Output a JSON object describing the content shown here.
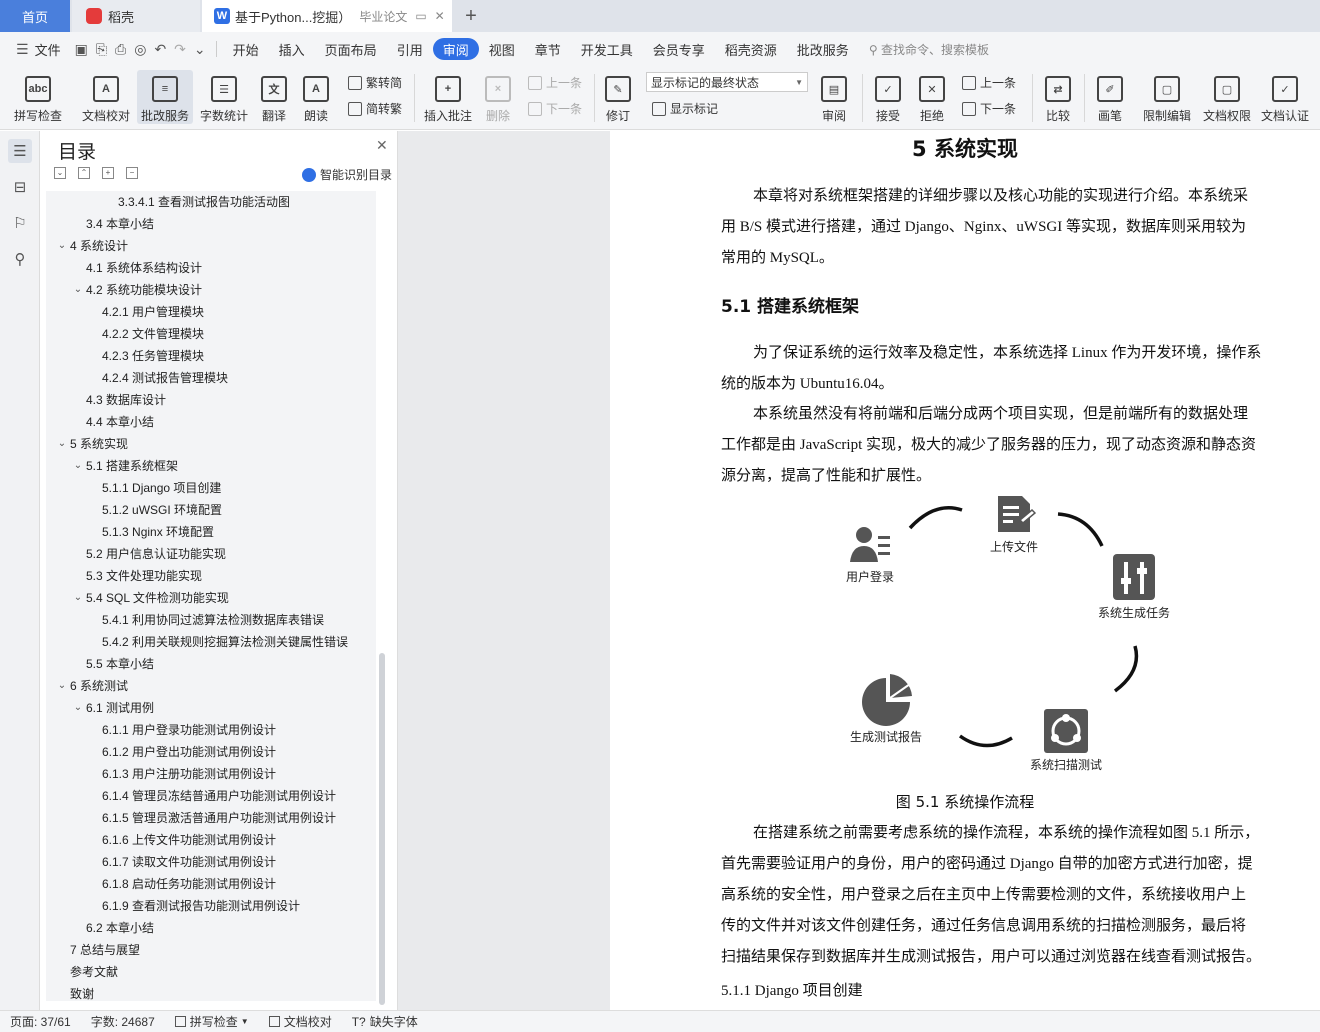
{
  "tabs": {
    "home": "首页",
    "docer": "稻壳",
    "doc_title": "基于Python...挖掘）",
    "doc_extra": "毕业论文"
  },
  "menubar": {
    "file": "文件",
    "items": [
      "开始",
      "插入",
      "页面布局",
      "引用",
      "审阅",
      "视图",
      "章节",
      "开发工具",
      "会员专享",
      "稻壳资源",
      "批改服务"
    ],
    "active_index": 4,
    "search": "查找命令、搜索模板"
  },
  "ribbon": {
    "spell": "拼写检查",
    "proofread": "文档校对",
    "review_service": "批改服务",
    "word_count": "字数统计",
    "translate": "翻译",
    "read_aloud": "朗读",
    "trad_to_simp": "繁转简",
    "simp_to_trad": "简转繁",
    "insert_comment": "插入批注",
    "delete": "删除",
    "prev_comment": "上一条",
    "next_comment": "下一条",
    "track": "修订",
    "markup_state": "显示标记的最终状态",
    "show_markup": "显示标记",
    "review_pane": "审阅",
    "accept": "接受",
    "reject": "拒绝",
    "prev_change": "上一条",
    "next_change": "下一条",
    "compare": "比较",
    "pen": "画笔",
    "restrict": "限制编辑",
    "permission": "文档权限",
    "certify": "文档认证"
  },
  "toc": {
    "title": "目录",
    "smart": "智能识别目录",
    "items": [
      {
        "text": "3.3.4.1  查看测试报告功能活动图",
        "level": 3,
        "ex": ""
      },
      {
        "text": "3.4  本章小结",
        "level": 1,
        "ex": ""
      },
      {
        "text": "4  系统设计",
        "level": 0,
        "ex": "v"
      },
      {
        "text": "4.1  系统体系结构设计",
        "level": 1,
        "ex": ""
      },
      {
        "text": "4.2  系统功能模块设计",
        "level": 1,
        "ex": "v"
      },
      {
        "text": "4.2.1  用户管理模块",
        "level": 2,
        "ex": ""
      },
      {
        "text": "4.2.2  文件管理模块",
        "level": 2,
        "ex": ""
      },
      {
        "text": "4.2.3  任务管理模块",
        "level": 2,
        "ex": ""
      },
      {
        "text": "4.2.4  测试报告管理模块",
        "level": 2,
        "ex": ""
      },
      {
        "text": "4.3  数据库设计",
        "level": 1,
        "ex": ""
      },
      {
        "text": "4.4  本章小结",
        "level": 1,
        "ex": ""
      },
      {
        "text": "5  系统实现",
        "level": 0,
        "ex": "v"
      },
      {
        "text": "5.1  搭建系统框架",
        "level": 1,
        "ex": "v"
      },
      {
        "text": "5.1.1 Django 项目创建",
        "level": 2,
        "ex": ""
      },
      {
        "text": "5.1.2 uWSGI 环境配置",
        "level": 2,
        "ex": ""
      },
      {
        "text": "5.1.3 Nginx 环境配置",
        "level": 2,
        "ex": ""
      },
      {
        "text": "5.2  用户信息认证功能实现",
        "level": 1,
        "ex": ""
      },
      {
        "text": "5.3  文件处理功能实现",
        "level": 1,
        "ex": ""
      },
      {
        "text": "5.4 SQL 文件检测功能实现",
        "level": 1,
        "ex": "v"
      },
      {
        "text": "5.4.1  利用协同过滤算法检测数据库表错误",
        "level": 2,
        "ex": ""
      },
      {
        "text": "5.4.2  利用关联规则挖掘算法检测关键属性错误",
        "level": 2,
        "ex": ""
      },
      {
        "text": "5.5  本章小结",
        "level": 1,
        "ex": ""
      },
      {
        "text": "6  系统测试",
        "level": 0,
        "ex": "v"
      },
      {
        "text": "6.1  测试用例",
        "level": 1,
        "ex": "v"
      },
      {
        "text": "6.1.1  用户登录功能测试用例设计",
        "level": 2,
        "ex": ""
      },
      {
        "text": "6.1.2  用户登出功能测试用例设计",
        "level": 2,
        "ex": ""
      },
      {
        "text": "6.1.3  用户注册功能测试用例设计",
        "level": 2,
        "ex": ""
      },
      {
        "text": "6.1.4  管理员冻结普通用户功能测试用例设计",
        "level": 2,
        "ex": ""
      },
      {
        "text": "6.1.5  管理员激活普通用户功能测试用例设计",
        "level": 2,
        "ex": ""
      },
      {
        "text": "6.1.6  上传文件功能测试用例设计",
        "level": 2,
        "ex": ""
      },
      {
        "text": "6.1.7  读取文件功能测试用例设计",
        "level": 2,
        "ex": ""
      },
      {
        "text": "6.1.8  启动任务功能测试用例设计",
        "level": 2,
        "ex": ""
      },
      {
        "text": "6.1.9  查看测试报告功能测试用例设计",
        "level": 2,
        "ex": ""
      },
      {
        "text": "6.2 本章小结",
        "level": 1,
        "ex": ""
      },
      {
        "text": "7  总结与展望",
        "level": 0,
        "ex": ""
      },
      {
        "text": "参考文献",
        "level": 0,
        "ex": ""
      },
      {
        "text": "致谢",
        "level": 0,
        "ex": ""
      }
    ]
  },
  "doc": {
    "chapter_title": "5  系统实现",
    "intro_lines": [
      "本章将对系统框架搭建的详细步骤以及核心功能的实现进行介绍。本系统采",
      "用 B/S 模式进行搭建，通过 Django、Nginx、uWSGI 等实现，数据库则采用较为",
      "常用的 MySQL。"
    ],
    "section_title": "5.1  搭建系统框架",
    "p1_lines": [
      "为了保证系统的运行效率及稳定性，本系统选择 Linux 作为开发环境，操作系",
      "统的版本为 Ubuntu16.04。"
    ],
    "p2_lines": [
      "本系统虽然没有将前端和后端分成两个项目实现，但是前端所有的数据处理",
      "工作都是由 JavaScript 实现，极大的减少了服务器的压力，现了动态资源和静态资",
      "源分离，提高了性能和扩展性。"
    ],
    "diagram": {
      "login": "用户登录",
      "upload": "上传文件",
      "task": "系统生成任务",
      "scan": "系统扫描测试",
      "report": "生成测试报告"
    },
    "figure_caption": "图 5.1  系统操作流程",
    "p3_lines": [
      "在搭建系统之前需要考虑系统的操作流程，本系统的操作流程如图 5.1 所示，",
      "首先需要验证用户的身份，用户的密码通过 Django 自带的加密方式进行加密，提",
      "高系统的安全性，用户登录之后在主页中上传需要检测的文件，系统接收用户上",
      "传的文件并对该文件创建任务，通过任务信息调用系统的扫描检测服务，最后将",
      "扫描结果保存到数据库并生成测试报告，用户可以通过浏览器在线查看测试报告。"
    ],
    "subsection_title": "5.1.1 Django 项目创建"
  },
  "status": {
    "page": "页面: 37/61",
    "words": "字数: 24687",
    "spell": "拼写检查",
    "proofread": "文档校对",
    "missing_font": "缺失字体"
  }
}
